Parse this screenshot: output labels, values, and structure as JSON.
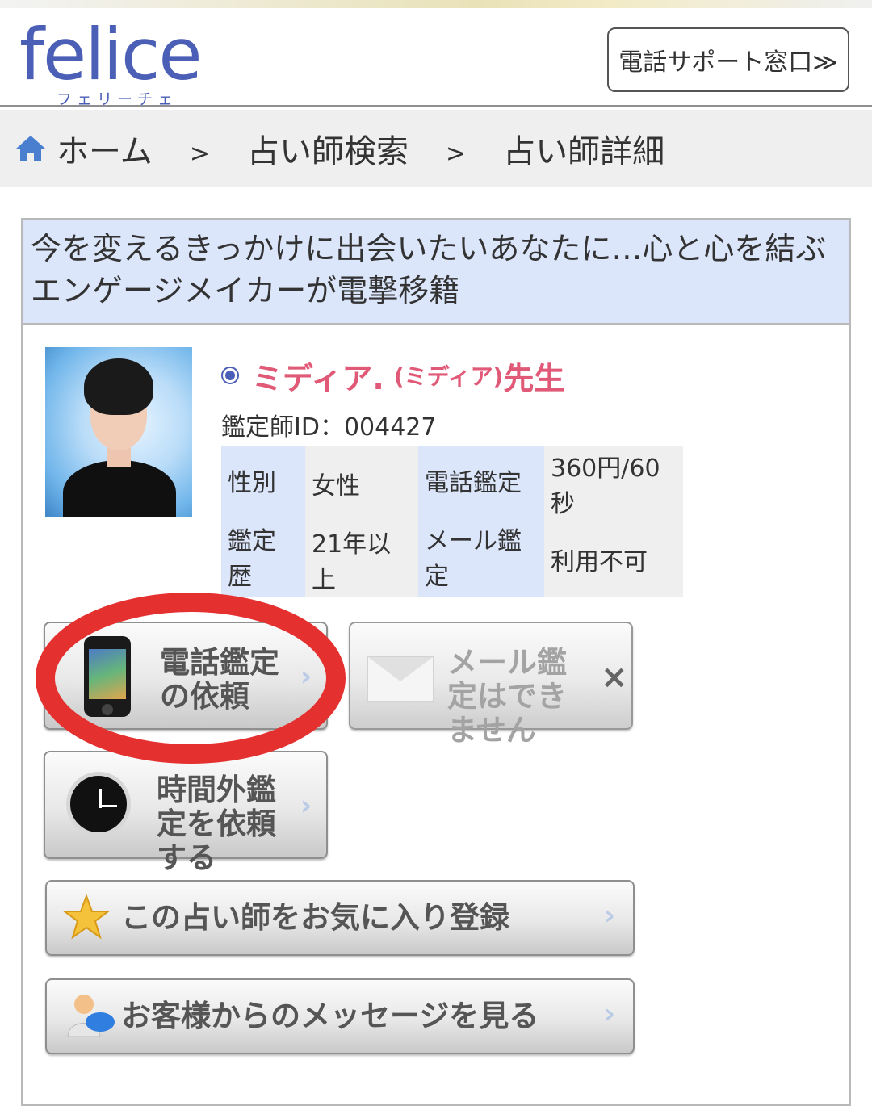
{
  "header": {
    "logo_text": "felice",
    "logo_sub": "フェリーチェ",
    "support_button": "電話サポート窓口≫"
  },
  "breadcrumb": {
    "items": [
      "ホーム",
      "占い師検索",
      "占い師詳細"
    ],
    "separator": ">"
  },
  "profile": {
    "headline": "今を変えるきっかけに出会いたいあなたに…心と心を結ぶエンゲージメイカーが電撃移籍",
    "name": "ミディア.",
    "name_kana": "(ミディア)",
    "name_suffix": "先生",
    "id_label": "鑑定師ID：004427",
    "specs": {
      "gender_label": "性別",
      "gender_value": "女性",
      "phone_label": "電話鑑定",
      "phone_value": "360円/60秒",
      "history_label": "鑑定歴",
      "history_value": "21年以上",
      "mail_label": "メール鑑定",
      "mail_value": "利用不可"
    }
  },
  "buttons": {
    "phone_request": "電話鑑定の依頼",
    "mail_unavailable": "メール鑑定はできません",
    "off_hours_request": "時間外鑑定を依頼する",
    "favorite": "この占い師をお気に入り登録",
    "messages": "お客様からのメッセージを見る",
    "chevron": "›",
    "close": "×"
  },
  "colors": {
    "brand": "#4a5fb5",
    "name_pink": "#e05a78",
    "header_bg": "#dce6fb",
    "highlight_red": "#e53030"
  }
}
